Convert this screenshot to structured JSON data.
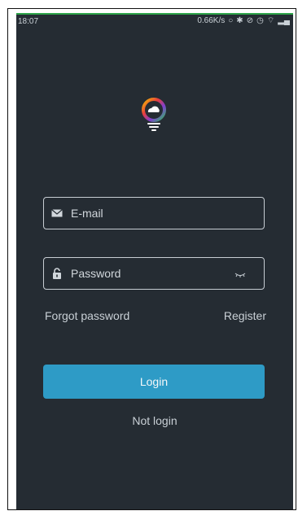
{
  "status_bar": {
    "time": "18:07",
    "network_speed": "0.66K/s",
    "icons": [
      "sync-icon",
      "bluetooth-icon",
      "mute-icon",
      "alarm-icon",
      "wifi-icon",
      "signal-icon"
    ]
  },
  "login_form": {
    "email_placeholder": "E-mail",
    "password_placeholder": "Password",
    "forgot_label": "Forgot password",
    "register_label": "Register",
    "login_label": "Login",
    "not_login_label": "Not login"
  },
  "colors": {
    "background": "#252c33",
    "accent": "#2e9bc6",
    "status_indicator": "#2ea54a"
  }
}
